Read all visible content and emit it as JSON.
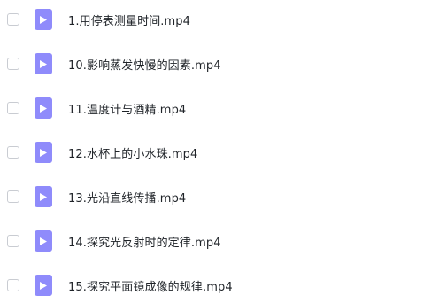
{
  "file_list": {
    "items": [
      {
        "name": "1.用停表测量时间.mp4",
        "icon": "video-file-icon",
        "checked": false
      },
      {
        "name": "10.影响蒸发快慢的因素.mp4",
        "icon": "video-file-icon",
        "checked": false
      },
      {
        "name": "11.温度计与酒精.mp4",
        "icon": "video-file-icon",
        "checked": false
      },
      {
        "name": "12.水杯上的小水珠.mp4",
        "icon": "video-file-icon",
        "checked": false
      },
      {
        "name": "13.光沿直线传播.mp4",
        "icon": "video-file-icon",
        "checked": false
      },
      {
        "name": "14.探究光反射时的定律.mp4",
        "icon": "video-file-icon",
        "checked": false
      },
      {
        "name": "15.探究平面镜成像的规律.mp4",
        "icon": "video-file-icon",
        "checked": false
      }
    ]
  },
  "colors": {
    "icon_bg": "#8f8bfb",
    "text": "#1f2328",
    "checkbox_border": "#c9ccd2"
  }
}
